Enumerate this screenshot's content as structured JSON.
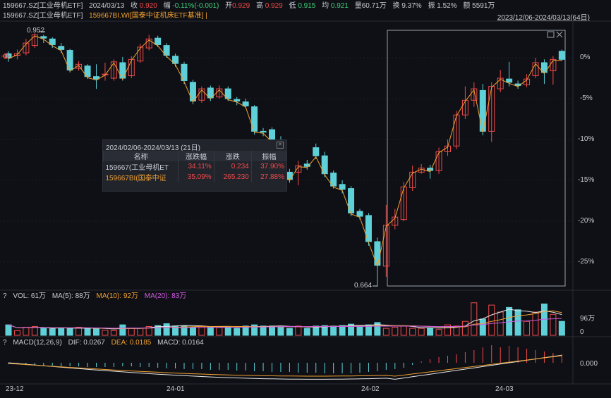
{
  "header": {
    "code": "159667.SZ[工业母机ETF]",
    "date": "2024/03/13",
    "close_label": "收",
    "close": "0.920",
    "change_label": "幅",
    "change": "-0.11%(-0.001)",
    "open_label": "开",
    "open": "0.929",
    "high_label": "高",
    "high": "0.929",
    "low_label": "低",
    "low": "0.915",
    "avg_label": "均",
    "avg": "0.921",
    "vol_label": "量",
    "vol": "60.71万",
    "turnover_label": "换",
    "turnover": "9.37%",
    "amp_label": "振",
    "amp": "1.52%",
    "amount_label": "额",
    "amount": "5591万"
  },
  "names": {
    "primary": "159667.SZ[工业母机ETF]",
    "compare": "159667BI.WI[国泰中证机床ETF基准] |"
  },
  "range_label": "2023/12/06-2024/03/13(64日)",
  "price_axis": [
    "0%",
    "-5%",
    "-10%",
    "-15%",
    "-20%",
    "-25%"
  ],
  "annotations": {
    "high": "0.952",
    "low": "0.664"
  },
  "popup": {
    "title": "2024/02/06-2024/03/13 (21日)",
    "headers": [
      "名称",
      "涨跌幅",
      "涨跌",
      "振幅"
    ],
    "rows": [
      {
        "name": "159667(工业母机ET",
        "pct": "34.11%",
        "chg": "0.234",
        "amp": "37.90%"
      },
      {
        "name": "159667BI(国泰中证",
        "pct": "35.09%",
        "chg": "265.230",
        "amp": "27.88%"
      }
    ]
  },
  "volume": {
    "label": "VOL: 61万",
    "ma5": "MA(5): 88万",
    "ma10": "MA(10): 92万",
    "ma20": "MA(20): 83万",
    "axis_top": "96万",
    "axis_zero": "0"
  },
  "macd": {
    "label": "MACD(12,26,9)",
    "dif": "DIF: 0.0267",
    "dea": "DEA: 0.0185",
    "macd": "MACD: 0.0164",
    "axis": "0.000"
  },
  "x_axis": [
    "23-12",
    "24-01",
    "24-02",
    "24-03"
  ],
  "colors": {
    "up": "#f04a4a",
    "down": "#5fd0d8",
    "ma": "#f0a030",
    "compare": "#f0a030",
    "purple": "#d05ae0"
  },
  "chart_data": {
    "type": "candlestick",
    "ylim_pct": [
      -28,
      3
    ],
    "candles": [
      {
        "o": 0.5,
        "c": 0.0,
        "h": 0.8,
        "l": -0.5
      },
      {
        "o": 0.3,
        "c": 0.5,
        "h": 1.0,
        "l": -0.2
      },
      {
        "o": 0.6,
        "c": 1.8,
        "h": 2.3,
        "l": 0.3
      },
      {
        "o": 1.5,
        "c": 2.8,
        "h": 3.0,
        "l": 1.2
      },
      {
        "o": 2.6,
        "c": 2.4,
        "h": 2.8,
        "l": 1.8
      },
      {
        "o": 2.3,
        "c": 1.6,
        "h": 2.5,
        "l": 1.2
      },
      {
        "o": 1.4,
        "c": 1.0,
        "h": 1.8,
        "l": 0.6
      },
      {
        "o": 0.9,
        "c": -1.5,
        "h": 1.1,
        "l": -1.8
      },
      {
        "o": -1.3,
        "c": -0.8,
        "h": -0.4,
        "l": -1.6
      },
      {
        "o": -1.0,
        "c": -2.3,
        "h": -0.8,
        "l": -2.6
      },
      {
        "o": -2.3,
        "c": -2.6,
        "h": -0.8,
        "l": -3.8
      },
      {
        "o": -2.1,
        "c": -2.0,
        "h": -0.6,
        "l": -2.8
      },
      {
        "o": -2.5,
        "c": -0.5,
        "h": -0.2,
        "l": -2.8
      },
      {
        "o": -0.6,
        "c": -2.5,
        "h": 0.1,
        "l": -2.8
      },
      {
        "o": -2.2,
        "c": -0.2,
        "h": 0.2,
        "l": -2.5
      },
      {
        "o": -0.4,
        "c": 1.3,
        "h": 1.7,
        "l": -0.6
      },
      {
        "o": 1.2,
        "c": 2.3,
        "h": 2.8,
        "l": 0.9
      },
      {
        "o": 2.4,
        "c": 1.6,
        "h": 2.7,
        "l": 1.3
      },
      {
        "o": 1.5,
        "c": 0.3,
        "h": 1.8,
        "l": 0.0
      },
      {
        "o": 0.2,
        "c": -0.7,
        "h": 0.5,
        "l": -1.1
      },
      {
        "o": -0.8,
        "c": -2.8,
        "h": -0.5,
        "l": -3.2
      },
      {
        "o": -3.0,
        "c": -5.3,
        "h": -2.7,
        "l": -5.7
      },
      {
        "o": -5.2,
        "c": -3.8,
        "h": -3.5,
        "l": -5.5
      },
      {
        "o": -3.7,
        "c": -4.9,
        "h": -3.4,
        "l": -5.3
      },
      {
        "o": -4.8,
        "c": -3.8,
        "h": -3.4,
        "l": -5.0
      },
      {
        "o": -3.8,
        "c": -5.0,
        "h": -3.5,
        "l": -5.3
      },
      {
        "o": -5.1,
        "c": -5.3,
        "h": -4.8,
        "l": -5.8
      },
      {
        "o": -5.4,
        "c": -5.9,
        "h": -5.0,
        "l": -6.2
      },
      {
        "o": -6.0,
        "c": -9.0,
        "h": -5.8,
        "l": -9.4
      },
      {
        "o": -9.0,
        "c": -9.1,
        "h": -8.6,
        "l": -9.6
      },
      {
        "o": -8.8,
        "c": -10.2,
        "h": -8.5,
        "l": -10.6
      },
      {
        "o": -10.1,
        "c": -13.8,
        "h": -9.6,
        "l": -15.2
      },
      {
        "o": -14.0,
        "c": -14.9,
        "h": -13.6,
        "l": -15.3
      },
      {
        "o": -14.0,
        "c": -13.2,
        "h": -12.6,
        "l": -15.6
      },
      {
        "o": -13.0,
        "c": -13.3,
        "h": -12.5,
        "l": -13.7
      },
      {
        "o": -11.0,
        "c": -12.0,
        "h": -10.5,
        "l": -12.4
      },
      {
        "o": -12.0,
        "c": -14.2,
        "h": -11.5,
        "l": -14.6
      },
      {
        "o": -14.1,
        "c": -15.7,
        "h": -13.8,
        "l": -16.0
      },
      {
        "o": -15.5,
        "c": -16.1,
        "h": -15.0,
        "l": -16.6
      },
      {
        "o": -16.0,
        "c": -19.0,
        "h": -15.7,
        "l": -19.4
      },
      {
        "o": -18.8,
        "c": -19.4,
        "h": -18.5,
        "l": -19.8
      },
      {
        "o": -19.3,
        "c": -22.5,
        "h": -19.0,
        "l": -23.0
      },
      {
        "o": -22.5,
        "c": -25.4,
        "h": -22.0,
        "l": -28.0
      },
      {
        "o": -25.5,
        "c": -20.5,
        "h": -18.0,
        "l": -26.8
      },
      {
        "o": -20.5,
        "c": -19.5,
        "h": -18.5,
        "l": -21.0
      },
      {
        "o": -19.8,
        "c": -15.8,
        "h": -15.2,
        "l": -20.0
      },
      {
        "o": -15.9,
        "c": -14.0,
        "h": -13.2,
        "l": -16.3
      },
      {
        "o": -14.0,
        "c": -13.5,
        "h": -13.0,
        "l": -14.2
      },
      {
        "o": -13.5,
        "c": -13.8,
        "h": -13.1,
        "l": -14.8
      },
      {
        "o": -13.8,
        "c": -11.5,
        "h": -11.0,
        "l": -14.2
      },
      {
        "o": -11.5,
        "c": -10.8,
        "h": -10.0,
        "l": -12.0
      },
      {
        "o": -10.8,
        "c": -7.0,
        "h": -6.5,
        "l": -11.2
      },
      {
        "o": -7.0,
        "c": -5.2,
        "h": -3.5,
        "l": -7.5
      },
      {
        "o": -5.2,
        "c": -3.8,
        "h": -3.0,
        "l": -6.0
      },
      {
        "o": -4.0,
        "c": -9.0,
        "h": -3.2,
        "l": -9.5
      },
      {
        "o": -9.0,
        "c": -3.5,
        "h": -3.0,
        "l": -10.3
      },
      {
        "o": -3.8,
        "c": -2.5,
        "h": -1.5,
        "l": -4.2
      },
      {
        "o": -2.6,
        "c": -3.0,
        "h": -0.5,
        "l": -3.5
      },
      {
        "o": -3.2,
        "c": -3.4,
        "h": -2.8,
        "l": -3.8
      },
      {
        "o": -3.3,
        "c": -2.6,
        "h": -2.0,
        "l": -3.6
      },
      {
        "o": -2.2,
        "c": -0.6,
        "h": 0.0,
        "l": -2.5
      },
      {
        "o": -0.6,
        "c": -1.8,
        "h": -0.2,
        "l": -3.2
      },
      {
        "o": -1.6,
        "c": -0.2,
        "h": 0.2,
        "l": -3.3
      },
      {
        "o": 0.8,
        "c": -0.2,
        "h": 1.0,
        "l": -0.4
      }
    ],
    "volumes": [
      45,
      20,
      35,
      38,
      30,
      28,
      30,
      30,
      35,
      30,
      30,
      22,
      20,
      45,
      30,
      30,
      38,
      42,
      50,
      40,
      40,
      35,
      38,
      35,
      35,
      35,
      30,
      40,
      45,
      40,
      40,
      38,
      30,
      40,
      30,
      40,
      42,
      40,
      42,
      48,
      40,
      45,
      55,
      30,
      35,
      40,
      30,
      30,
      30,
      25,
      45,
      40,
      60,
      140,
      70,
      130,
      100,
      120,
      110,
      60,
      100,
      135,
      90,
      60
    ],
    "macd_bars": [
      -2,
      -2,
      -3,
      -3,
      -4,
      -4,
      -5,
      -5,
      -5,
      -6,
      -6,
      -6,
      -6,
      -5,
      -5,
      -6,
      -6,
      -7,
      -8,
      -8,
      -9,
      -9,
      -9,
      -10,
      -10,
      -10,
      -11,
      -11,
      -12,
      -12,
      -13,
      -13,
      -13,
      -14,
      -14,
      -14,
      -15,
      -15,
      -15,
      -15,
      -14,
      -13,
      -12,
      -10,
      -9,
      -7,
      -3,
      2,
      5,
      8,
      10,
      12,
      15,
      18,
      22,
      25,
      22,
      24,
      22,
      20,
      18,
      16,
      14,
      12
    ]
  }
}
